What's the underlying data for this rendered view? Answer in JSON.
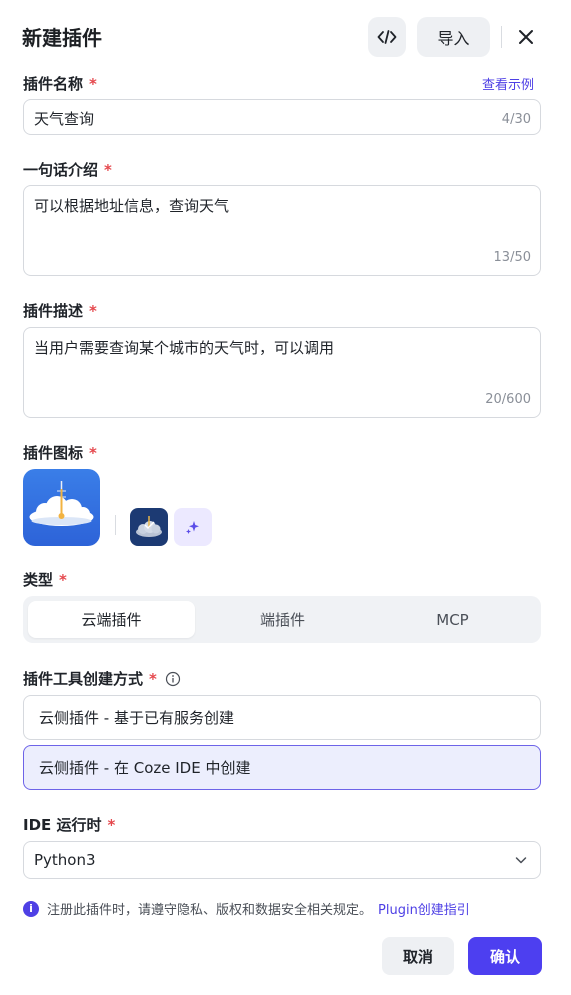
{
  "dialog": {
    "title": "新建插件",
    "code_icon": "code-icon",
    "import_label": "导入",
    "close_icon": "close-icon"
  },
  "name": {
    "label": "插件名称",
    "required": "*",
    "example_link": "查看示例",
    "value": "天气查询",
    "count": "4/30"
  },
  "intro": {
    "label": "一句话介绍",
    "required": "*",
    "value": "可以根据地址信息，查询天气",
    "count": "13/50"
  },
  "description": {
    "label": "插件描述",
    "required": "*",
    "value": "当用户需要查询某个城市的天气时，可以调用",
    "count": "20/600"
  },
  "plugin_icon": {
    "label": "插件图标",
    "required": "*",
    "main_icon": "cloud-thermometer-icon",
    "alt_icon": "cloud-thumbnail-icon",
    "ai_generate_icon": "sparkle-icon"
  },
  "type": {
    "label": "类型",
    "required": "*",
    "options": [
      "云端插件",
      "端插件",
      "MCP"
    ],
    "selected": "云端插件"
  },
  "creation": {
    "label": "插件工具创建方式",
    "required": "*",
    "info_icon": "info-icon",
    "options": [
      "云侧插件 - 基于已有服务创建",
      "云侧插件 - 在 Coze IDE 中创建"
    ],
    "selected": "云侧插件 - 在 Coze IDE 中创建"
  },
  "runtime": {
    "label": "IDE 运行时",
    "required": "*",
    "value": "Python3",
    "chevron_icon": "chevron-down-icon"
  },
  "notice": {
    "icon": "info-icon",
    "text": "注册此插件时，请遵守隐私、版权和数据安全相关规定。",
    "link": "Plugin创建指引"
  },
  "footer": {
    "cancel_label": "取消",
    "confirm_label": "确认"
  },
  "colors": {
    "accent": "#4d3ff0",
    "required": "#e5484d",
    "selected_bg": "#eceefd"
  }
}
